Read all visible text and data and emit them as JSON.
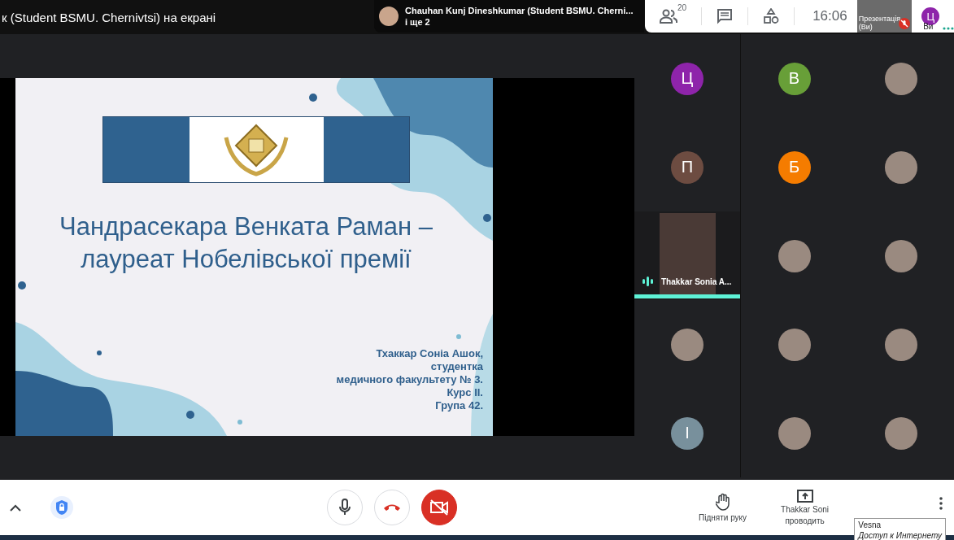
{
  "header": {
    "title": "к (Student BSMU. Chernivtsi) на екрані"
  },
  "notification": {
    "name": "Chauhan Kunj Dineshkumar (Student BSMU. Cherni...",
    "more": "і ще 2"
  },
  "toolbar": {
    "participant_count": "20",
    "time": "16:06",
    "self_preview_label": "Презентація (Ви)",
    "self_preview_muted": true,
    "self_avatar": "Ц",
    "self_label": "Ви"
  },
  "slide": {
    "title_lines": [
      "Чандрасекара Венката Раман –",
      "лауреат Нобелівської премії"
    ],
    "author_lines": [
      "Тхаккар Соніа Ашок,",
      "студентка",
      "медичного факультету № 3.",
      "Курс ІІ.",
      "Група 42."
    ]
  },
  "participants": [
    {
      "kind": "letter",
      "letter": "Ц",
      "color": "#8e24aa"
    },
    {
      "kind": "letter",
      "letter": "В",
      "color": "#689f38"
    },
    {
      "kind": "photo"
    },
    {
      "kind": "letter",
      "letter": "П",
      "color": "#6d4c41"
    },
    {
      "kind": "letter",
      "letter": "Б",
      "color": "#f57c00"
    },
    {
      "kind": "photo"
    },
    {
      "kind": "video",
      "name": "Thakkar Sonia A...",
      "speaking": true
    },
    {
      "kind": "photo"
    },
    {
      "kind": "photo"
    },
    {
      "kind": "photo"
    },
    {
      "kind": "photo"
    },
    {
      "kind": "photo"
    },
    {
      "kind": "letter",
      "letter": "I",
      "color": "#78909c"
    },
    {
      "kind": "photo"
    },
    {
      "kind": "photo"
    }
  ],
  "controls": {
    "mic_muted": false,
    "camera_off": true,
    "raise_hand": "Підняти руку",
    "presenter_lines": [
      "Thakkar Soni",
      "проводить"
    ]
  },
  "tooltip": {
    "title": "Vesna",
    "subtitle": "Доступ к Интернету"
  }
}
